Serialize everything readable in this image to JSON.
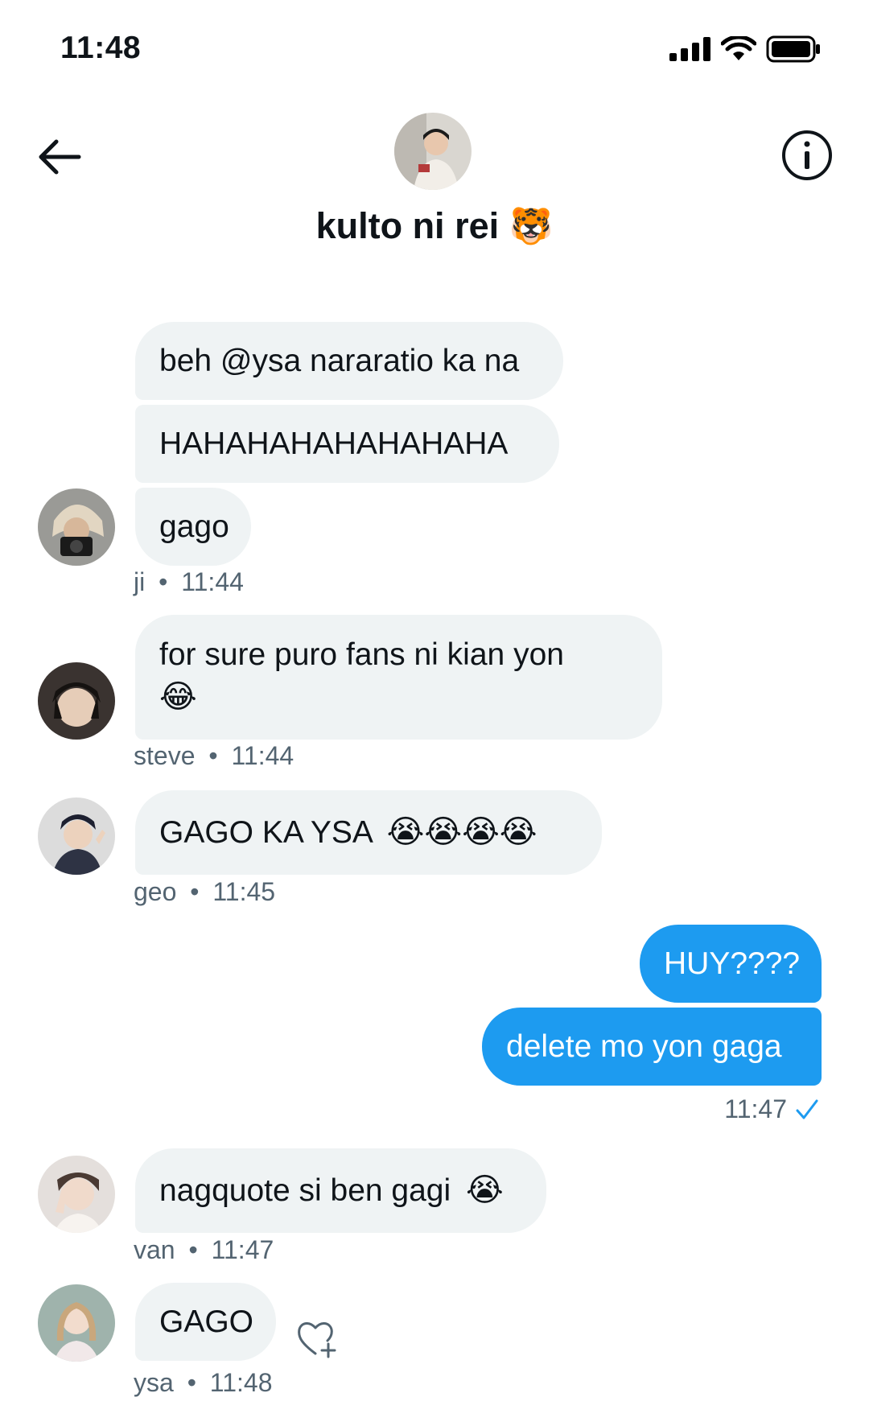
{
  "status_bar": {
    "time": "11:48"
  },
  "header": {
    "title": "kulto ni rei",
    "title_emoji": "🐯"
  },
  "messages": [
    {
      "text": "beh @ysa nararatio ka na"
    },
    {
      "text": "HAHAHAHAHAHAHAHA"
    },
    {
      "text": "gago",
      "sender": "ji",
      "time": "11:44"
    },
    {
      "text": "for sure puro fans ni kian yon",
      "emoji": "😂",
      "sender": "steve",
      "time": "11:44"
    },
    {
      "text": "GAGO KA YSA",
      "emoji": "😭😭😭😭",
      "sender": "geo",
      "time": "11:45"
    },
    {
      "text": "HUY????"
    },
    {
      "text": "delete mo yon gaga",
      "time": "11:47"
    },
    {
      "text": "nagquote si ben gagi",
      "emoji": "😭",
      "sender": "van",
      "time": "11:47"
    },
    {
      "text": "GAGO",
      "sender": "ysa",
      "time": "11:48"
    }
  ],
  "separator": "•",
  "colors": {
    "accent": "#1d9bf0",
    "bubble_in": "#eff3f4",
    "meta": "#536471"
  }
}
